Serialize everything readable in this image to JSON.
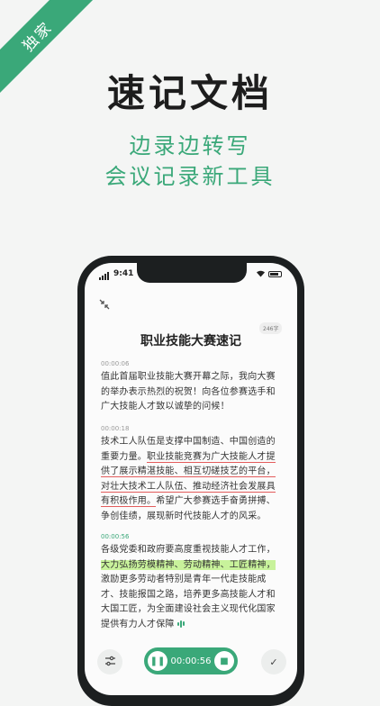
{
  "promo": {
    "ribbon": "独家",
    "headline": "速记文档",
    "subline1": "边录边转写",
    "subline2": "会议记录新工具"
  },
  "status_bar": {
    "time": "9:41"
  },
  "document": {
    "char_count": "246字",
    "title": "职业技能大赛速记",
    "paragraphs": [
      {
        "timestamp": "00:00:06",
        "segments": [
          {
            "text": "值此首届职业技能大赛开幕之际，我向大赛的举办表示热烈的祝贺！向各位参赛选手和广大技能人才致以诚挚的问候！",
            "style": "plain"
          }
        ]
      },
      {
        "timestamp": "00:00:18",
        "segments": [
          {
            "text": "技术工人队伍是支撑中国制造、中国创造的重要力量。",
            "style": "plain"
          },
          {
            "text": "职业技能竞赛为广大技能人才提供了展示精湛技能、相互切磋技艺的平台，对壮大技术工人队伍、推动经济社会发展具有积极作用。",
            "style": "underline"
          },
          {
            "text": "希望广大参赛选手奋勇拼搏、争创佳绩，展现新时代技能人才的风采。",
            "style": "plain"
          }
        ]
      },
      {
        "timestamp": "00:00:56",
        "segments": [
          {
            "text": "各级党委和政府要高度重视技能人才工作，",
            "style": "plain"
          },
          {
            "text": "大力弘扬劳模精神、劳动精神、工匠精神，",
            "style": "highlight"
          },
          {
            "text": "激励更多劳动者特别是青年一代走技能成才、技能报国之路，培养更多高技能人才和大国工匠，为全面建设社会主义现代化国家提供有力人才保障",
            "style": "plain"
          }
        ]
      }
    ]
  },
  "controls": {
    "recording_time": "00:00:56",
    "settings_icon": "sliders-icon",
    "confirm_icon": "check-icon"
  },
  "colors": {
    "accent": "#3aa879",
    "underline": "#e35c5c",
    "highlight": "#c8f29b"
  }
}
